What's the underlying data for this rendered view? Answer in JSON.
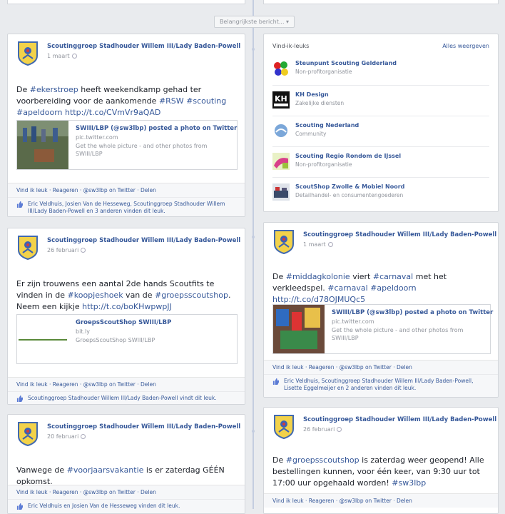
{
  "filter": {
    "label": "Belangrijkste bericht... ▾"
  },
  "page_name": "Scoutinggroep Stadhouder Willem III/Lady Baden-Powell",
  "actions": {
    "like": "Vind ik leuk",
    "comment": "Reageren",
    "twitter": "@sw3lbp on Twitter",
    "share": "Delen",
    "sep": "·"
  },
  "posts": [
    {
      "date": "1 maart",
      "text_parts": [
        "De ",
        "#ekerstroep",
        " heeft weekendkamp gehad ter voorbereiding voor de aankomende ",
        "#RSW",
        " ",
        "#scouting",
        " ",
        "#apeldoorn",
        " ",
        "http://t.co/CVmVr9aQAD"
      ],
      "link_title": "SWIII/LBP (@sw3lbp) posted a photo on Twitter",
      "link_src": "pic.twitter.com",
      "link_desc": "Get the whole picture - and other photos from SWIII/LBP",
      "likes": "Eric Veldhuis, Josien Van de Hesseweg, Scoutinggroep Stadhouder Willem III/Lady Baden-Powell en 3 anderen vinden dit leuk."
    },
    {
      "date": "26 februari",
      "text_parts": [
        "Er zijn trouwens een aantal 2de hands Scoutfits te vinden in de ",
        "#koopjeshoek",
        " van de ",
        "#groepsscoutshop",
        ". Neem een kijkje ",
        "http://t.co/boKHwpwpJJ"
      ],
      "link_title": "GroepsScoutShop SWIII/LBP",
      "link_src": "bit.ly",
      "link_desc": "GroepsScoutShop SWIII/LBP",
      "likes": "Scoutinggroep Stadhouder Willem III/Lady Baden-Powell vindt dit leuk."
    },
    {
      "date": "20 februari",
      "text_parts": [
        "Vanwege de ",
        "#voorjaarsvakantie",
        " is er zaterdag GÉÉN opkomst."
      ],
      "likes": "Eric Veldhuis en Josien Van de Hesseweg vinden dit leuk."
    },
    {
      "date": "1 maart",
      "text_parts": [
        "De ",
        "#middagkolonie",
        " viert ",
        "#carnaval",
        " met het verkleedspel. ",
        "#carnaval",
        " ",
        "#apeldoorn",
        " ",
        "http://t.co/d78OJMUQc5"
      ],
      "link_title": "SWIII/LBP (@sw3lbp) posted a photo on Twitter",
      "link_src": "pic.twitter.com",
      "link_desc": "Get the whole picture - and other photos from SWIII/LBP",
      "likes": "Eric Veldhuis, Scoutinggroep Stadhouder Willem III/Lady Baden-Powell, Lisette Eggelmeijer en 2 anderen vinden dit leuk."
    },
    {
      "date": "26 februari",
      "text_parts": [
        "De ",
        "#groepsscoutshop",
        " is zaterdag weer geopend! Alle bestellingen kunnen, voor één keer, van 9:30 uur tot 17:00 uur opgehaald worden! ",
        "#sw3lbp"
      ]
    }
  ],
  "likes_box": {
    "header": "Vind-ik-leuks",
    "see_all": "Alles weergeven",
    "items": [
      {
        "name": "Steunpunt Scouting Gelderland",
        "category": "Non-profitorganisatie"
      },
      {
        "name": "KH Design",
        "category": "Zakelijke diensten"
      },
      {
        "name": "Scouting Nederland",
        "category": "Community"
      },
      {
        "name": "Scouting Regio Rondom de IJssel",
        "category": "Non-profitorganisatie"
      },
      {
        "name": "ScoutShop Zwolle & Mobiel Noord",
        "category": "Detailhandel- en consumentengoederen"
      }
    ]
  },
  "colors": {
    "link": "#365899",
    "muted": "#90949c",
    "bg": "#e9ebee",
    "spine": "#c4cde0"
  }
}
